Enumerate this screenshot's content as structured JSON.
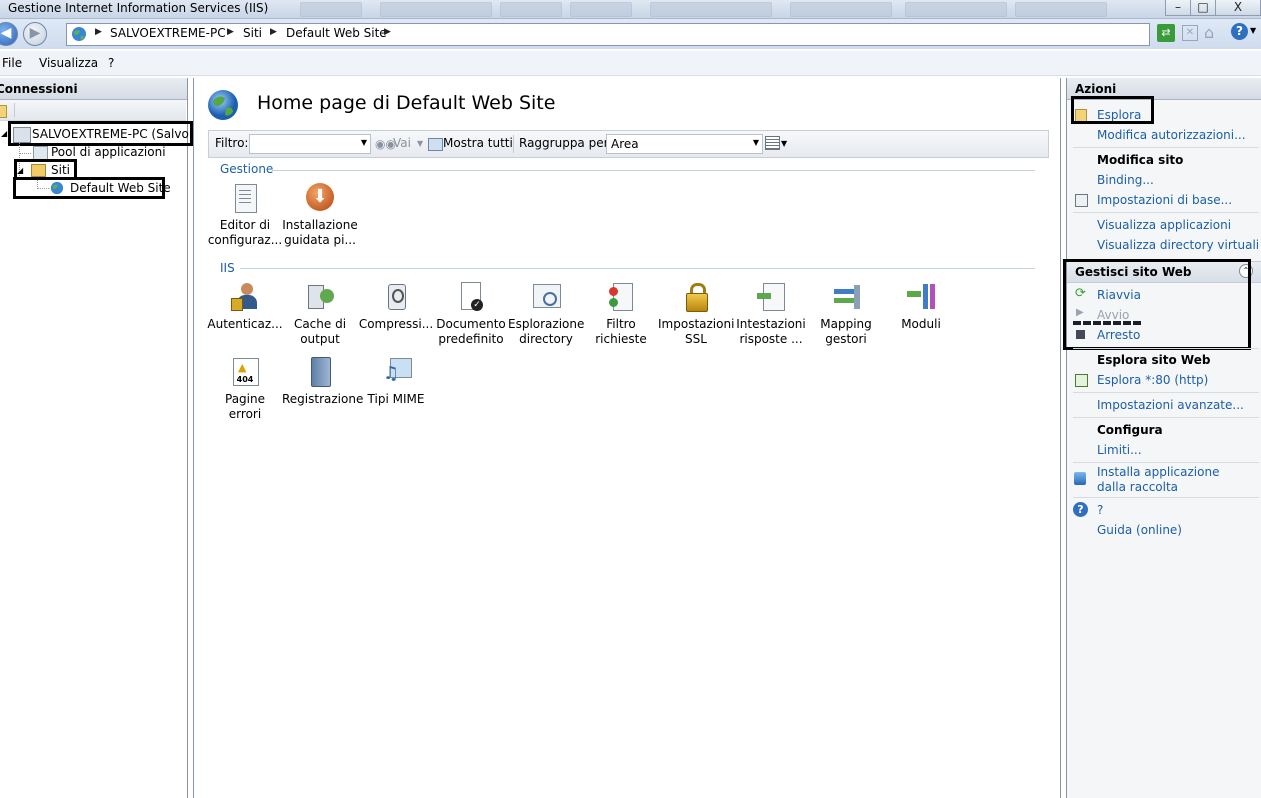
{
  "window": {
    "title": "Gestione Internet Information Services (IIS)",
    "controls": {
      "minimize": "–",
      "maximize": "□",
      "close": "X"
    }
  },
  "address": {
    "breadcrumbs": [
      "SALVOEXTREME-PC",
      "Siti",
      "Default Web Site"
    ]
  },
  "menu": {
    "items": [
      "File",
      "Visualizza",
      "?"
    ]
  },
  "connections": {
    "header": "Connessioni",
    "tree": {
      "server": "SALVOEXTREME-PC (SalvoExt",
      "app_pools": "Pool di applicazioni",
      "sites": "Siti",
      "site": "Default Web Site"
    }
  },
  "center": {
    "title": "Home page di Default Web Site",
    "toolbar": {
      "filter_label": "Filtro:",
      "go_label": "Vai",
      "show_all_label": "Mostra tutti",
      "group_by_label": "Raggruppa per:",
      "group_by_value": "Area"
    },
    "groups": {
      "gestione": {
        "label": "Gestione",
        "items": [
          {
            "label": "Editor di configuraz...",
            "icon": "config-editor-icon"
          },
          {
            "label": "Installazione guidata pi...",
            "icon": "install-download-icon"
          }
        ]
      },
      "iis": {
        "label": "IIS",
        "items": [
          {
            "label": "Autenticaz...",
            "icon": "authentication-icon"
          },
          {
            "label": "Cache di output",
            "icon": "output-cache-icon"
          },
          {
            "label": "Compressi...",
            "icon": "compression-icon"
          },
          {
            "label": "Documento predefinito",
            "icon": "default-document-icon"
          },
          {
            "label": "Esplorazione directory",
            "icon": "directory-browsing-icon"
          },
          {
            "label": "Filtro richieste",
            "icon": "request-filter-icon"
          },
          {
            "label": "Impostazioni SSL",
            "icon": "ssl-lock-icon"
          },
          {
            "label": "Intestazioni risposte ...",
            "icon": "response-headers-icon"
          },
          {
            "label": "Mapping gestori",
            "icon": "handler-mappings-icon"
          },
          {
            "label": "Moduli",
            "icon": "modules-icon"
          },
          {
            "label": "Pagine errori",
            "icon": "error-pages-icon",
            "badge": "404"
          },
          {
            "label": "Registrazione",
            "icon": "logging-icon"
          },
          {
            "label": "Tipi MIME",
            "icon": "mime-types-icon"
          }
        ]
      }
    }
  },
  "actions": {
    "header": "Azioni",
    "explore": "Esplora",
    "edit_permissions": "Modifica autorizzazioni...",
    "edit_site_header": "Modifica sito",
    "binding": "Binding...",
    "basic_settings": "Impostazioni di base...",
    "view_apps": "Visualizza applicazioni",
    "view_vdirs": "Visualizza directory virtuali",
    "manage_header": "Gestisci sito Web",
    "restart": "Riavvia",
    "start": "Avvio",
    "stop": "Arresto",
    "browse_header": "Esplora sito Web",
    "browse_80": "Esplora *:80 (http)",
    "advanced": "Impostazioni avanzate...",
    "configure_header": "Configura",
    "limits": "Limiti...",
    "install_app": "Installa applicazione dalla raccolta",
    "help_q": "?",
    "online_help": "Guida (online)"
  },
  "colors": {
    "link": "#1b5fa8",
    "highlight_box": "#000000"
  }
}
